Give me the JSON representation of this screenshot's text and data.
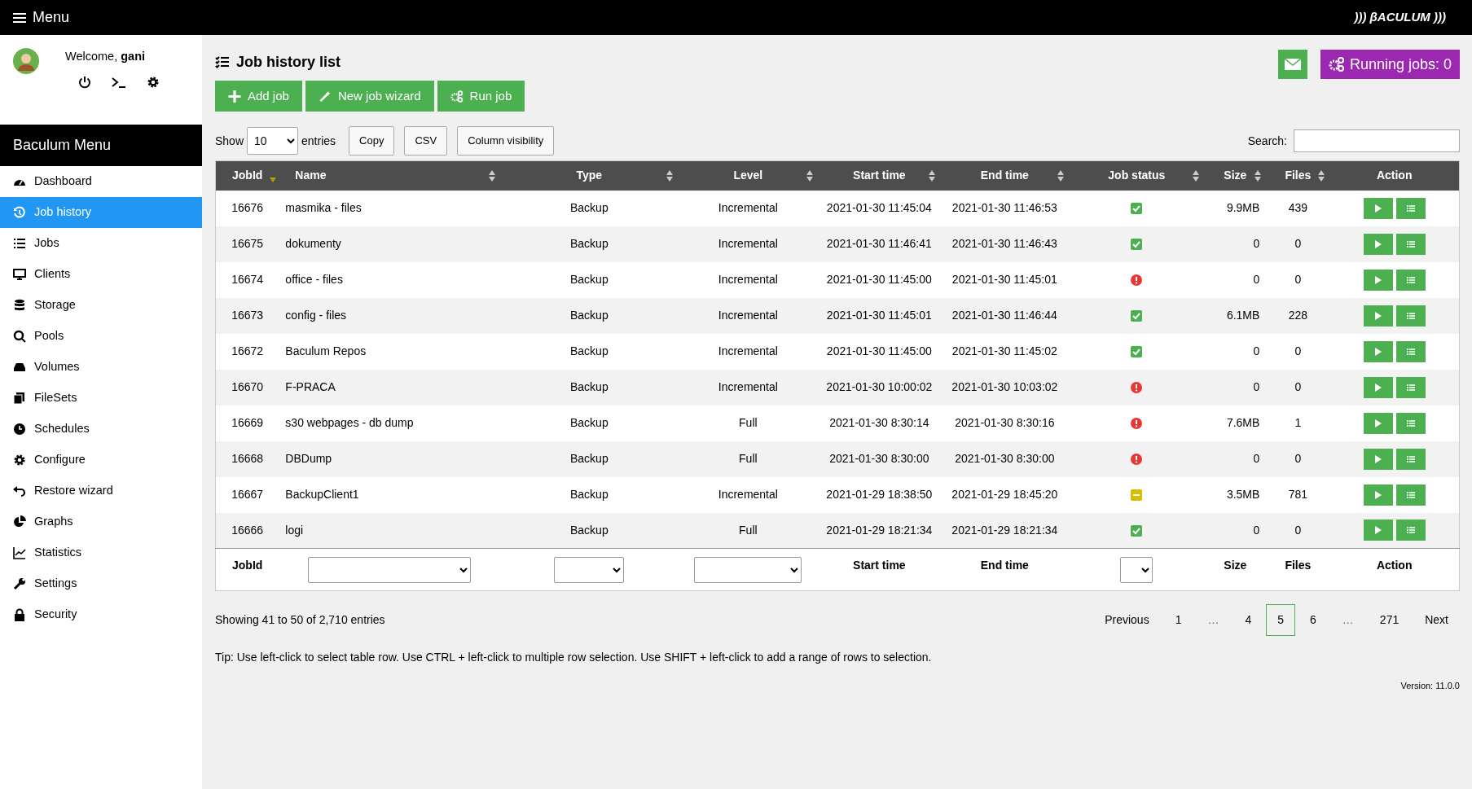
{
  "topbar": {
    "menu_label": "Menu",
    "logo": "))) βACULUM )))"
  },
  "user": {
    "welcome": "Welcome, **gani**"
  },
  "sidebar": {
    "title": "Baculum Menu",
    "items": [
      {
        "label": "Dashboard",
        "selected": false
      },
      {
        "label": "Job history",
        "selected": true
      },
      {
        "label": "Jobs",
        "selected": false
      },
      {
        "label": "Clients",
        "selected": false
      },
      {
        "label": "Storage",
        "selected": false
      },
      {
        "label": "Pools",
        "selected": false
      },
      {
        "label": "Volumes",
        "selected": false
      },
      {
        "label": "FileSets",
        "selected": false
      },
      {
        "label": "Schedules",
        "selected": false
      },
      {
        "label": "Configure",
        "selected": false
      },
      {
        "label": "Restore wizard",
        "selected": false
      },
      {
        "label": "Graphs",
        "selected": false
      },
      {
        "label": "Statistics",
        "selected": false
      },
      {
        "label": "Settings",
        "selected": false
      },
      {
        "label": "Security",
        "selected": false
      }
    ]
  },
  "page_title": "Job history list",
  "running_jobs": "Running jobs: 0",
  "actions": [
    "Add job",
    "New job wizard",
    "Run job"
  ],
  "table_controls": {
    "show_label": "Show",
    "page_size": "10",
    "entries_label": "entries",
    "buttons": [
      "Copy",
      "CSV",
      "Column visibility"
    ],
    "search_label": "Search:"
  },
  "table": {
    "columns": [
      {
        "label": "JobId",
        "sortable": true,
        "sorted": true
      },
      {
        "label": "Name",
        "sortable": true,
        "sorted": false
      },
      {
        "label": "Type",
        "sortable": true,
        "sorted": false
      },
      {
        "label": "Level",
        "sortable": true,
        "sorted": false
      },
      {
        "label": "Start time",
        "sortable": true,
        "sorted": false
      },
      {
        "label": "End time",
        "sortable": true,
        "sorted": false
      },
      {
        "label": "Job status",
        "sortable": true,
        "sorted": false
      },
      {
        "label": "Size",
        "sortable": true,
        "sorted": false
      },
      {
        "label": "Files",
        "sortable": true,
        "sorted": false
      },
      {
        "label": "Action",
        "sortable": false
      }
    ],
    "rows": [
      {
        "jobid": "16676",
        "name": "masmika - files",
        "type": "Backup",
        "level": "Incremental",
        "start": "2021-01-30 11:45:04",
        "end": "2021-01-30 11:46:53",
        "status": {
          "kind": "ok"
        },
        "size": "9.9MB",
        "files": "439"
      },
      {
        "jobid": "16675",
        "name": "dokumenty",
        "type": "Backup",
        "level": "Incremental",
        "start": "2021-01-30 11:46:41",
        "end": "2021-01-30 11:46:43",
        "status": {
          "kind": "ok"
        },
        "size": "0",
        "files": "0"
      },
      {
        "jobid": "16674",
        "name": "office - files",
        "type": "Backup",
        "level": "Incremental",
        "start": "2021-01-30 11:45:00",
        "end": "2021-01-30 11:45:01",
        "status": {
          "kind": "error"
        },
        "size": "0",
        "files": "0"
      },
      {
        "jobid": "16673",
        "name": "config - files",
        "type": "Backup",
        "level": "Incremental",
        "start": "2021-01-30 11:45:01",
        "end": "2021-01-30 11:46:44",
        "status": {
          "kind": "ok"
        },
        "size": "6.1MB",
        "files": "228"
      },
      {
        "jobid": "16672",
        "name": "Baculum Repos",
        "type": "Backup",
        "level": "Incremental",
        "start": "2021-01-30 11:45:00",
        "end": "2021-01-30 11:45:02",
        "status": {
          "kind": "ok"
        },
        "size": "0",
        "files": "0"
      },
      {
        "jobid": "16670",
        "name": "F-PRACA",
        "type": "Backup",
        "level": "Incremental",
        "start": "2021-01-30 10:00:02",
        "end": "2021-01-30 10:03:02",
        "status": {
          "kind": "error"
        },
        "size": "0",
        "files": "0"
      },
      {
        "jobid": "16669",
        "name": "s30 webpages - db dump",
        "type": "Backup",
        "level": "Full",
        "start": "2021-01-30 8:30:14",
        "end": "2021-01-30 8:30:16",
        "status": {
          "kind": "error"
        },
        "size": "7.6MB",
        "files": "1"
      },
      {
        "jobid": "16668",
        "name": "DBDump",
        "type": "Backup",
        "level": "Full",
        "start": "2021-01-30 8:30:00",
        "end": "2021-01-30 8:30:00",
        "status": {
          "kind": "error"
        },
        "size": "0",
        "files": "0"
      },
      {
        "jobid": "16667",
        "name": "BackupClient1",
        "type": "Backup",
        "level": "Incremental",
        "start": "2021-01-29 18:38:50",
        "end": "2021-01-29 18:45:20",
        "status": {
          "kind": "warning"
        },
        "size": "3.5MB",
        "files": "781"
      },
      {
        "jobid": "16666",
        "name": "logi",
        "type": "Backup",
        "level": "Full",
        "start": "2021-01-29 18:21:34",
        "end": "2021-01-29 18:21:34",
        "status": {
          "kind": "ok"
        },
        "size": "0",
        "files": "0"
      }
    ],
    "footer": [
      {
        "kind": "text",
        "label": "JobId"
      },
      {
        "kind": "select"
      },
      {
        "kind": "select"
      },
      {
        "kind": "select"
      },
      {
        "kind": "text",
        "label": "Start time"
      },
      {
        "kind": "text",
        "label": "End time"
      },
      {
        "kind": "select"
      },
      {
        "kind": "text",
        "label": "Size"
      },
      {
        "kind": "text",
        "label": "Files"
      },
      {
        "kind": "text",
        "label": "Action"
      }
    ]
  },
  "info": "Showing 41 to 50 of 2,710 entries",
  "pagination": [
    {
      "label": "Previous",
      "kind": "link",
      "selected": false
    },
    {
      "label": "1",
      "kind": "link",
      "selected": false
    },
    {
      "label": "…",
      "kind": "ellipsis"
    },
    {
      "label": "4",
      "kind": "link",
      "selected": false
    },
    {
      "label": "5",
      "kind": "link",
      "selected": true
    },
    {
      "label": "6",
      "kind": "link",
      "selected": false
    },
    {
      "label": "…",
      "kind": "ellipsis"
    },
    {
      "label": "271",
      "kind": "link",
      "selected": false
    },
    {
      "label": "Next",
      "kind": "link",
      "selected": false
    }
  ],
  "tip": "Tip: Use left-click to select table row. Use CTRL + left-click to multiple row selection. Use SHIFT + left-click to add a range of rows to selection.",
  "version": "Version: 11.0.0"
}
